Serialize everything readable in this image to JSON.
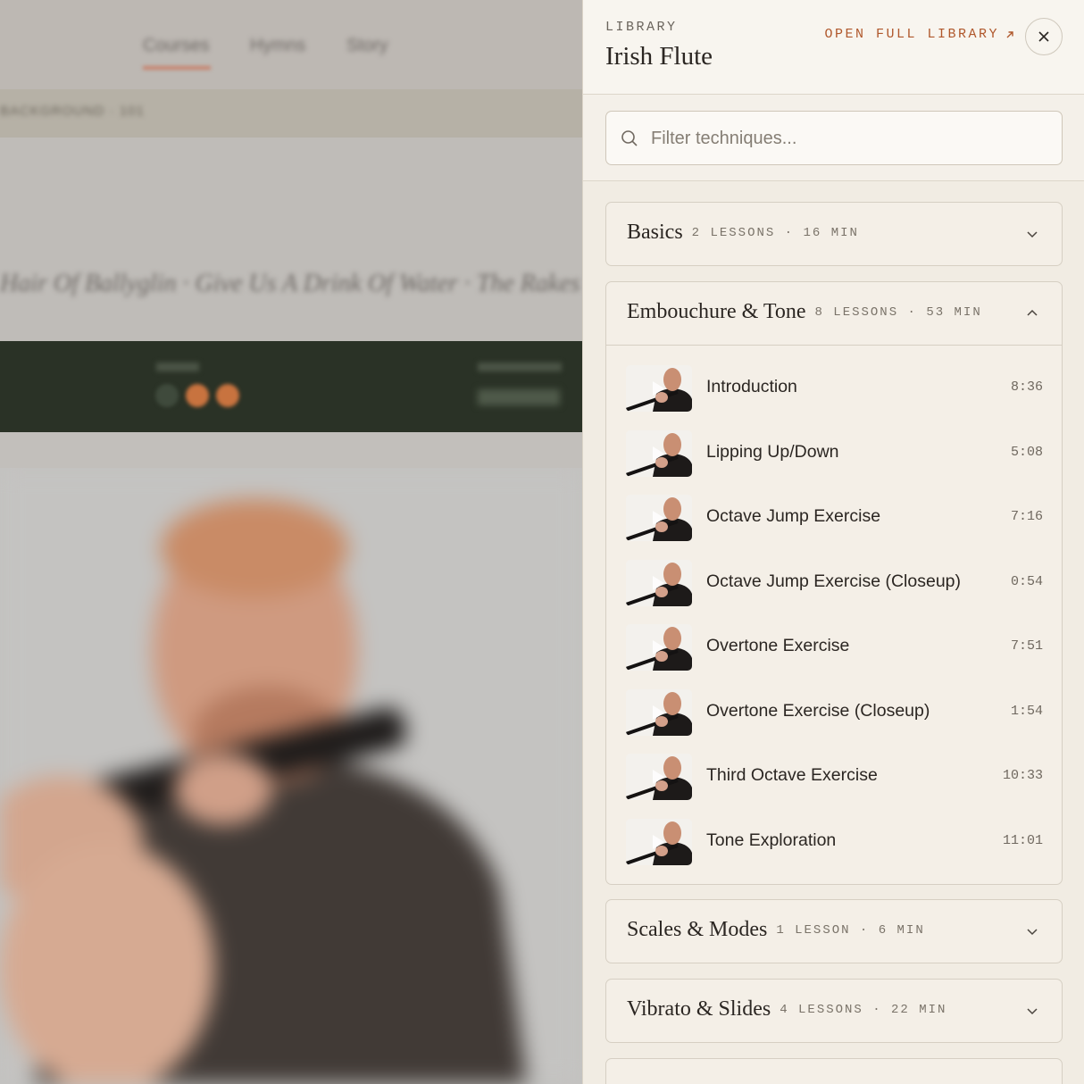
{
  "background_page": {
    "nav_tabs": [
      "Courses",
      "Hymns",
      "Story"
    ],
    "breadcrumb": "BACKGROUND · 101",
    "hero_text": "Hair Of Ballyglin · Give Us A Drink Of Water · The Rakes Of Drumaddy"
  },
  "panel": {
    "eyebrow": "LIBRARY",
    "title": "Irish Flute",
    "open_full_library": "OPEN FULL LIBRARY",
    "search": {
      "placeholder": "Filter techniques..."
    },
    "sections": [
      {
        "name": "Basics",
        "meta": "2 LESSONS · 16 MIN",
        "expanded": false
      },
      {
        "name": "Embouchure & Tone",
        "meta": "8 LESSONS · 53 MIN",
        "expanded": true,
        "lessons": [
          {
            "title": "Introduction",
            "duration": "8:36"
          },
          {
            "title": "Lipping Up/Down",
            "duration": "5:08"
          },
          {
            "title": "Octave Jump Exercise",
            "duration": "7:16"
          },
          {
            "title": "Octave Jump Exercise (Closeup)",
            "duration": "0:54"
          },
          {
            "title": "Overtone Exercise",
            "duration": "7:51"
          },
          {
            "title": "Overtone Exercise (Closeup)",
            "duration": "1:54"
          },
          {
            "title": "Third Octave Exercise",
            "duration": "10:33"
          },
          {
            "title": "Tone Exploration",
            "duration": "11:01"
          }
        ]
      },
      {
        "name": "Scales & Modes",
        "meta": "1 LESSON · 6 MIN",
        "expanded": false
      },
      {
        "name": "Vibrato & Slides",
        "meta": "4 LESSONS · 22 MIN",
        "expanded": false
      }
    ]
  },
  "colors": {
    "accent": "#b0582c",
    "panel_bg": "#f1ece3",
    "background_band": "#2a3226"
  },
  "icons": [
    "search-icon",
    "close-icon",
    "external-link-icon",
    "chevron-down-icon",
    "chevron-up-icon",
    "play-icon"
  ]
}
